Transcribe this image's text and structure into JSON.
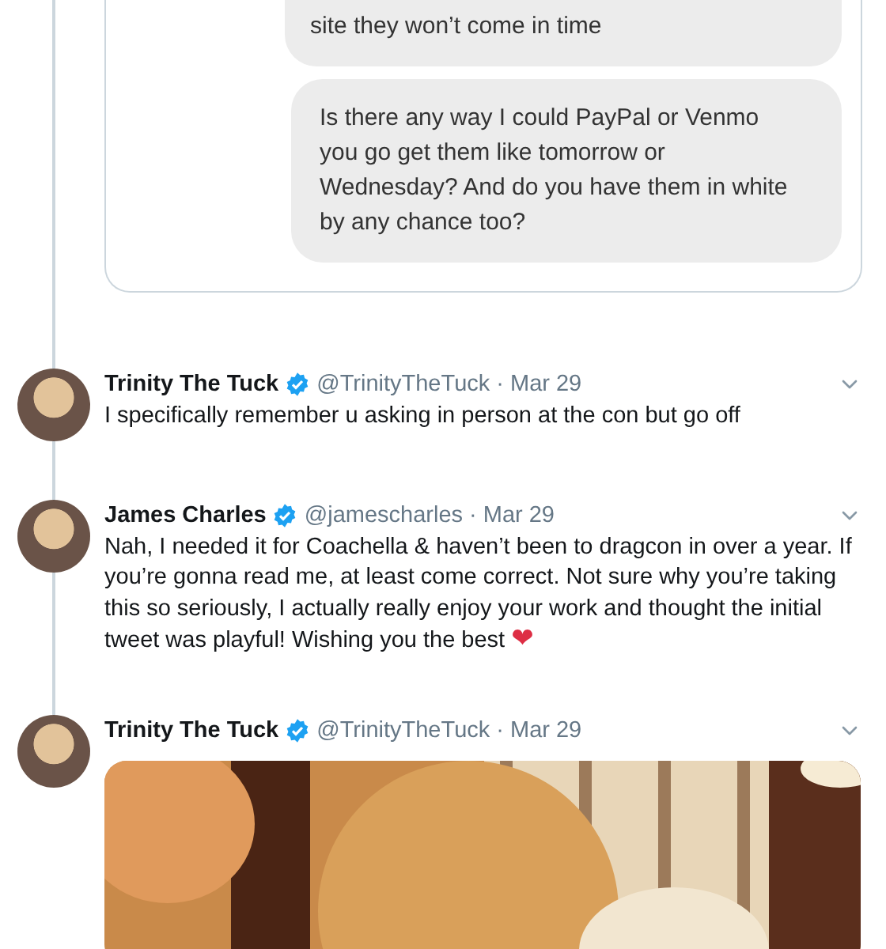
{
  "quoted_dm": {
    "messages": [
      {
        "text": "site they won’t come in time"
      },
      {
        "text": "Is there any way I could PayPal or Venmo you go get them like tomorrow or Wednesday? And do you have them in white by any chance too?"
      }
    ]
  },
  "tweets": [
    {
      "name": "Trinity The Tuck",
      "verified": true,
      "handle": "@TrinityTheTuck",
      "date": "· Mar 29",
      "text": "I specifically remember u asking in person at the con but go off"
    },
    {
      "name": "James Charles",
      "verified": true,
      "handle": "@jamescharles",
      "date": "· Mar 29",
      "text": "Nah, I needed it for Coachella & haven’t been to dragcon in over a year. If you’re gonna read me, at least come correct. Not sure why you’re taking this so seriously, I actually really enjoy your work and thought the initial tweet was playful! Wishing you the best",
      "heart": "❤"
    },
    {
      "name": "Trinity The Tuck",
      "verified": true,
      "handle": "@TrinityTheTuck",
      "date": "· Mar 29"
    }
  ]
}
